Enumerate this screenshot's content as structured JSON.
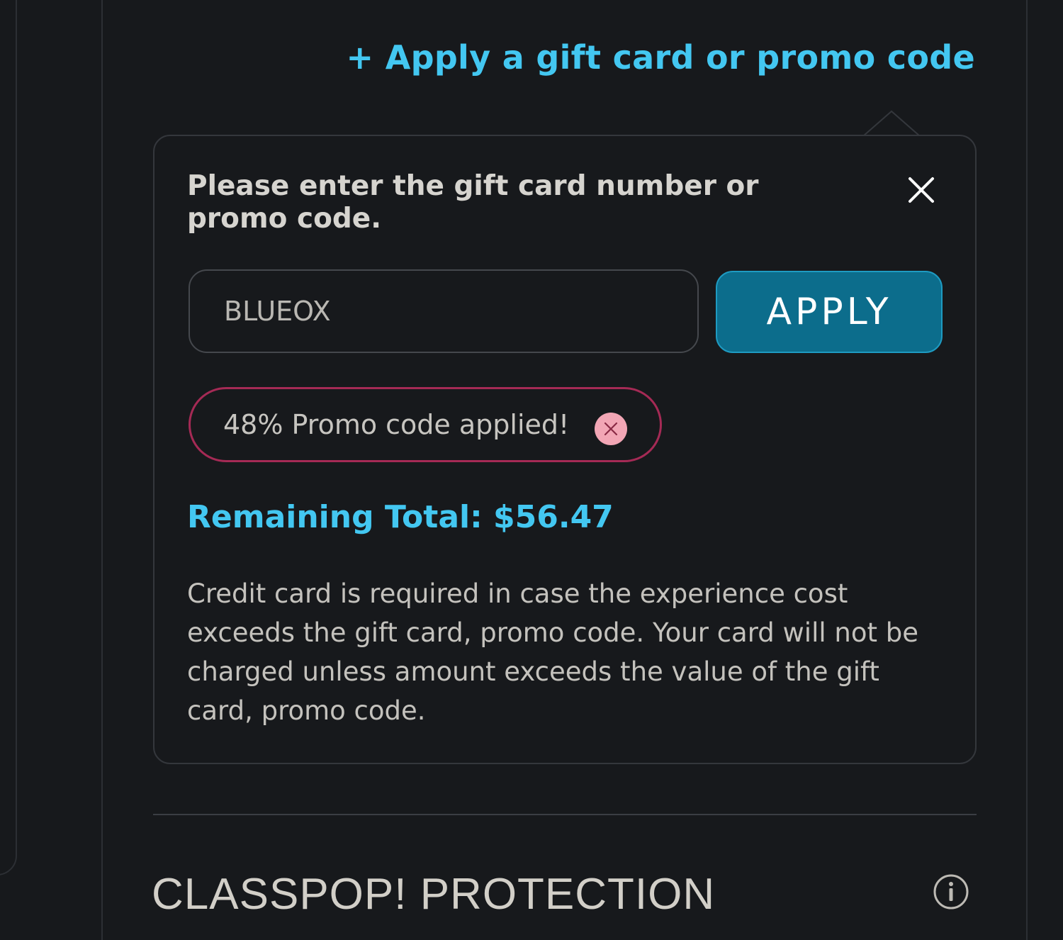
{
  "promo_toggle": {
    "label": "+ Apply a gift card or promo code"
  },
  "popover": {
    "title": "Please enter the gift card number or promo code.",
    "close_icon": "close-icon",
    "input": {
      "value": "BLUEOX",
      "placeholder": ""
    },
    "apply_label": "APPLY",
    "applied_badge": {
      "text": "48% Promo code applied!",
      "remove_icon": "remove-icon"
    },
    "remaining_total": "Remaining Total: $56.47",
    "disclaimer": "Credit card is required in case the experience cost exceeds the gift card, promo code. Your card will not be charged unless amount exceeds the value of the gift card, promo code."
  },
  "protection": {
    "title": "CLASSPOP! PROTECTION",
    "info_icon": "info-icon"
  },
  "colors": {
    "background": "#17191c",
    "accent": "#43c7f1",
    "apply_button": "#0c6d8c",
    "badge_border": "#a52a55",
    "badge_remove": "#f2a6b5"
  }
}
